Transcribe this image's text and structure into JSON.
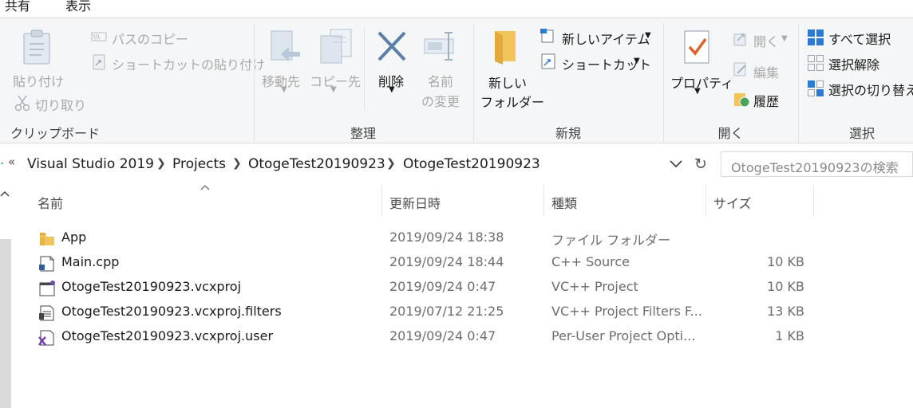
{
  "tabs": [
    "共有",
    "表示"
  ],
  "ribbon": {
    "clipboard": {
      "paste": "貼り付け",
      "copy_path": "パスのコピー",
      "paste_shortcut": "ショートカットの貼り付け",
      "cut": "切り取り",
      "group": "クリップボード"
    },
    "organize": {
      "move_to": "移動先",
      "copy_to": "コピー先",
      "delete": "削除",
      "rename_1": "名前",
      "rename_2": "の変更",
      "group": "整理"
    },
    "new": {
      "new_folder_1": "新しい",
      "new_folder_2": "フォルダー",
      "new_item": "新しいアイテム",
      "shortcut": "ショートカット",
      "group": "新規"
    },
    "open": {
      "properties": "プロパティ",
      "open": "開く",
      "edit": "編集",
      "history": "履歴",
      "group": "開く"
    },
    "select": {
      "select_all": "すべて選択",
      "select_none": "選択解除",
      "invert": "選択の切り替え",
      "group": "選択"
    }
  },
  "address": {
    "overflow": "«",
    "crumbs": [
      "Visual Studio 2019",
      "Projects",
      "OtogeTest20190923",
      "OtogeTest20190923"
    ],
    "search_placeholder": "OtogeTest20190923の検索"
  },
  "columns": {
    "name": "名前",
    "date": "更新日時",
    "type": "種類",
    "size": "サイズ"
  },
  "files": [
    {
      "name": "App",
      "date": "2019/09/24 18:38",
      "type": "ファイル フォルダー",
      "size": "",
      "icon": "folder-icon"
    },
    {
      "name": "Main.cpp",
      "date": "2019/09/24 18:44",
      "type": "C++ Source",
      "size": "10 KB",
      "icon": "cpp-file-icon"
    },
    {
      "name": "OtogeTest20190923.vcxproj",
      "date": "2019/09/24 0:47",
      "type": "VC++ Project",
      "size": "10 KB",
      "icon": "vcxproj-file-icon"
    },
    {
      "name": "OtogeTest20190923.vcxproj.filters",
      "date": "2019/07/12 21:25",
      "type": "VC++ Project Filters F...",
      "size": "13 KB",
      "icon": "filters-file-icon"
    },
    {
      "name": "OtogeTest20190923.vcxproj.user",
      "date": "2019/09/24 0:47",
      "type": "Per-User Project Opti...",
      "size": "1 KB",
      "icon": "user-file-icon"
    }
  ],
  "colors": {
    "ribbon_bg": "#f5f6f7",
    "folder": "#f2c55c",
    "accent_blue": "#2b7bd6",
    "delete_x": "#5b7fa6",
    "disabled_text": "#a9a9a9"
  }
}
